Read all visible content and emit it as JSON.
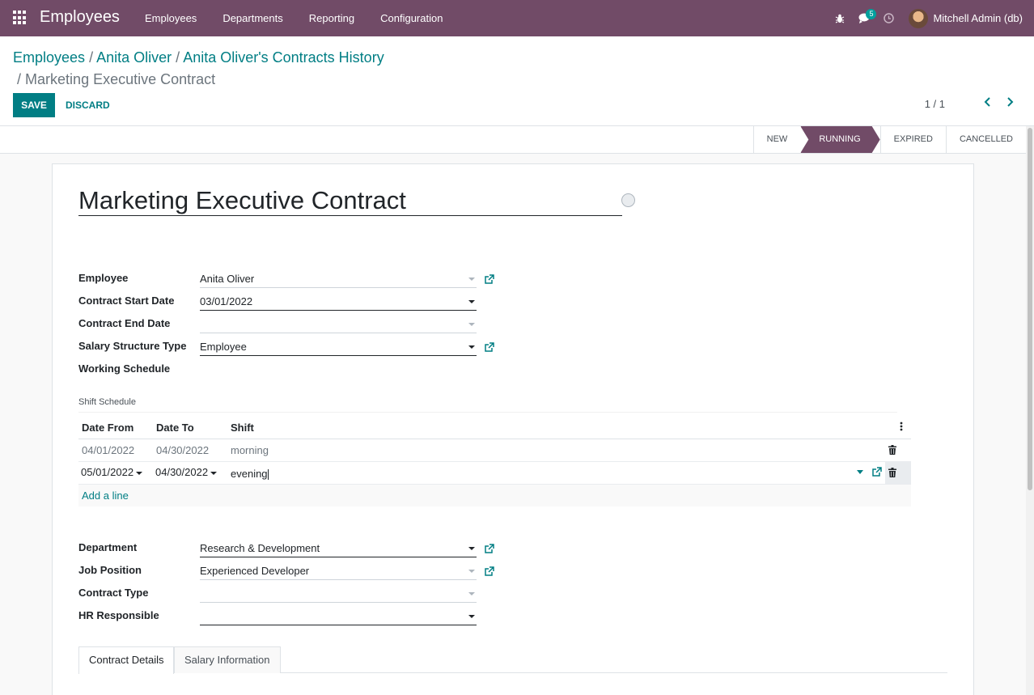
{
  "navbar": {
    "app_name": "Employees",
    "menu": [
      "Employees",
      "Departments",
      "Reporting",
      "Configuration"
    ],
    "messages_count": "5",
    "user_name": "Mitchell Admin (db)"
  },
  "breadcrumb": {
    "items": [
      "Employees",
      "Anita Oliver",
      "Anita Oliver's Contracts History"
    ],
    "separator": "/",
    "active": "Marketing Executive Contract"
  },
  "actions": {
    "save": "SAVE",
    "discard": "DISCARD"
  },
  "pager": {
    "value": "1 / 1"
  },
  "stages": {
    "new": "NEW",
    "running": "RUNNING",
    "expired": "EXPIRED",
    "cancelled": "CANCELLED",
    "current": "RUNNING"
  },
  "form": {
    "title": "Marketing Executive Contract",
    "fields": {
      "employee": {
        "label": "Employee",
        "value": "Anita Oliver"
      },
      "start_date": {
        "label": "Contract Start Date",
        "value": "03/01/2022"
      },
      "end_date": {
        "label": "Contract End Date",
        "value": ""
      },
      "salary_structure_type": {
        "label": "Salary Structure Type",
        "value": "Employee"
      },
      "working_schedule": {
        "label": "Working Schedule",
        "value": ""
      },
      "department": {
        "label": "Department",
        "value": "Research & Development"
      },
      "job_position": {
        "label": "Job Position",
        "value": "Experienced Developer"
      },
      "contract_type": {
        "label": "Contract Type",
        "value": ""
      },
      "hr_responsible": {
        "label": "HR Responsible",
        "value": ""
      }
    },
    "shift_schedule": {
      "title": "Shift Schedule",
      "columns": [
        "Date From",
        "Date To",
        "Shift"
      ],
      "rows": [
        {
          "date_from": "04/01/2022",
          "date_to": "04/30/2022",
          "shift": "morning"
        },
        {
          "date_from": "05/01/2022",
          "date_to": "04/30/2022",
          "shift": "evening"
        }
      ],
      "add_line": "Add a line"
    },
    "tabs": [
      "Contract Details",
      "Salary Information"
    ]
  },
  "colors": {
    "brand": "#714b67",
    "accent": "#017e84"
  }
}
